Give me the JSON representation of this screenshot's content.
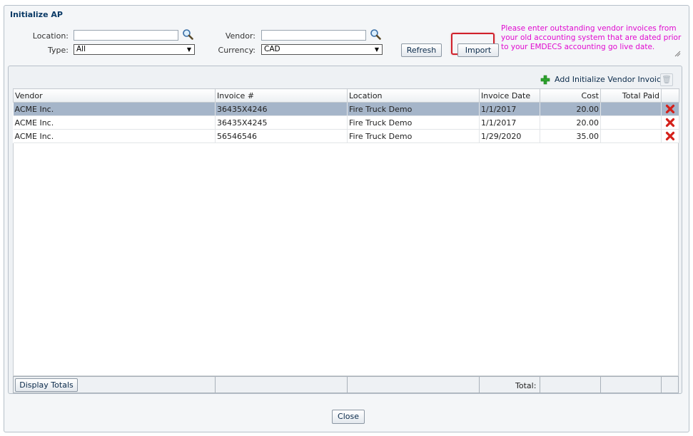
{
  "window": {
    "title": "Initialize AP"
  },
  "filters": {
    "location_label": "Location:",
    "location_value": "",
    "type_label": "Type:",
    "type_value": "All",
    "vendor_label": "Vendor:",
    "vendor_value": "",
    "currency_label": "Currency:",
    "currency_value": "CAD"
  },
  "actions": {
    "refresh_label": "Refresh",
    "import_label": "Import"
  },
  "note": "Please enter outstanding vendor invoices from your old accounting system that are dated prior to your EMDECS accounting go live date.",
  "grid": {
    "add_label": "Add Initialize Vendor Invoice",
    "columns": [
      "Vendor",
      "Invoice #",
      "Location",
      "Invoice Date",
      "Cost",
      "Total Paid",
      ""
    ],
    "rows": [
      {
        "vendor": "ACME Inc.",
        "invoice": "36435X4246",
        "location": "Fire Truck Demo",
        "date": "1/1/2017",
        "cost": "20.00",
        "paid": "",
        "selected": true
      },
      {
        "vendor": "ACME Inc.",
        "invoice": "36435X4245",
        "location": "Fire Truck Demo",
        "date": "1/1/2017",
        "cost": "20.00",
        "paid": "",
        "selected": false
      },
      {
        "vendor": "ACME Inc.",
        "invoice": "56546546",
        "location": "Fire Truck Demo",
        "date": "1/29/2020",
        "cost": "35.00",
        "paid": "",
        "selected": false
      }
    ],
    "display_totals_label": "Display Totals",
    "total_label": "Total:"
  },
  "close_label": "Close",
  "icons": {
    "search": "magnifier-icon",
    "add": "green-plus-icon",
    "delete": "red-x-icon",
    "trash": "trash-icon",
    "dropdown": "chevron-down-icon"
  },
  "colors": {
    "title": "#0a3a66",
    "note": "#e00ad0",
    "selected_row": "#a5b5c9",
    "link": "#1a4d9e",
    "import_highlight": "#d0212b"
  }
}
